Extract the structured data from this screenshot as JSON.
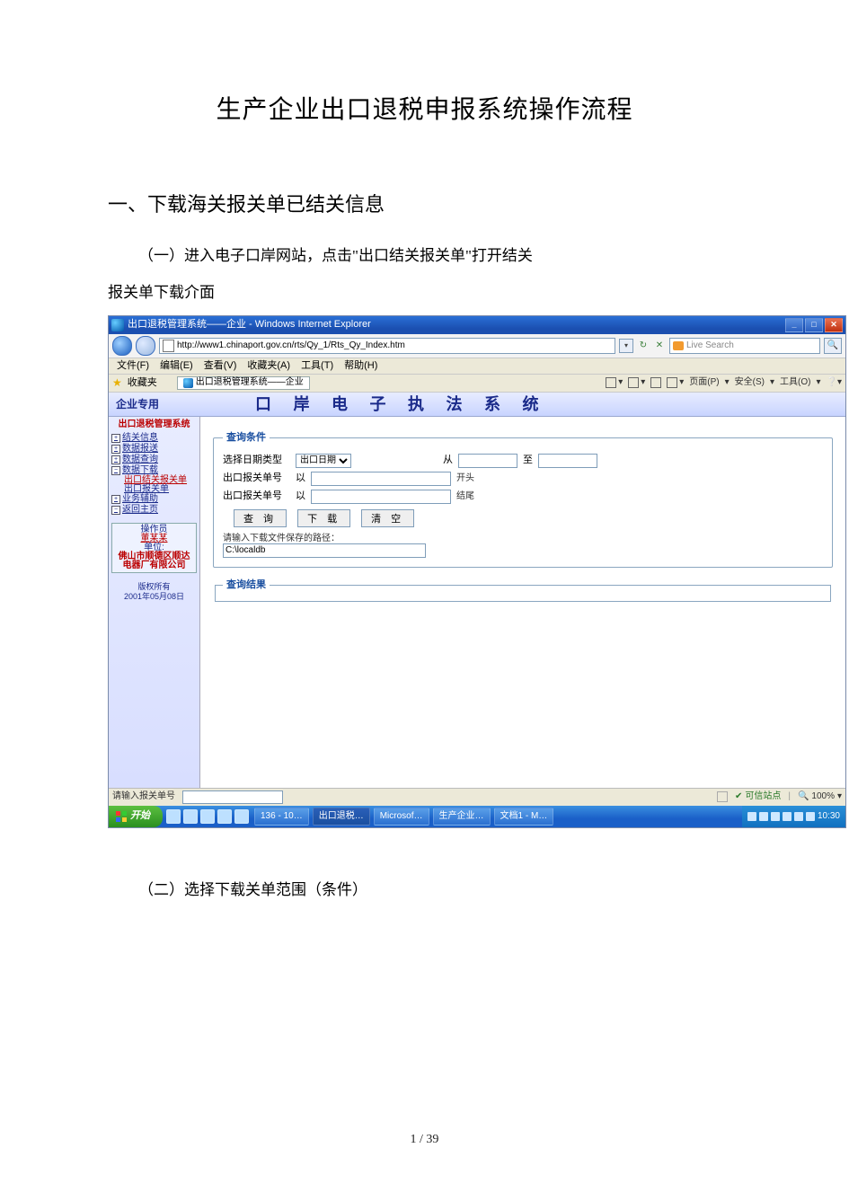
{
  "doc": {
    "title": "生产企业出口退税申报系统操作流程",
    "section1": "一、下载海关报关单已结关信息",
    "p1a": "（一）进入电子口岸网站，点击\"出口结关报关单\"打开结关",
    "p1b": "报关单下载介面",
    "p2": "（二）选择下载关单范围（条件）",
    "page_number": "1 / 39"
  },
  "ie": {
    "window_title": "出口退税管理系统——企业 - Windows Internet Explorer",
    "url": "http://www1.chinaport.gov.cn/rts/Qy_1/Rts_Qy_Index.htm",
    "search_placeholder": "Live Search",
    "menu": {
      "file": "文件(F)",
      "edit": "编辑(E)",
      "view": "查看(V)",
      "favorites": "收藏夹(A)",
      "tools": "工具(T)",
      "help": "帮助(H)"
    },
    "fav_label": "收藏夹",
    "tab_title": "出口退税管理系统——企业",
    "toolbar": {
      "page": "页面(P)",
      "safety": "安全(S)",
      "tools": "工具(O)"
    },
    "status": {
      "prompt": "请输入报关单号",
      "trusted": "可信站点",
      "zoom": "100%"
    }
  },
  "app": {
    "left_heading": "企业专用",
    "banner": "口 岸 电 子 执 法 系 统",
    "sidebar": {
      "title": "出口退税管理系统",
      "items": {
        "customs_info": "结关信息",
        "data_send": "数据报送",
        "data_query": "数据查询",
        "data_download": "数据下载",
        "sub_export_customs": "出口结关报关单",
        "sub_export_form": "出口报关单",
        "biz_support": "业务辅助",
        "back_home": "返回主页"
      },
      "operator_label": "操作员",
      "operator_name": "董某某",
      "company_label": "单位:",
      "company_name": "佛山市顺德区顺达电器厂有限公司",
      "copyright_l1": "版权所有",
      "copyright_l2": "2001年05月08日"
    },
    "form": {
      "legend_query": "查询条件",
      "label_date_type": "选择日期类型",
      "date_type_option": "出口日期",
      "label_from": "从",
      "label_to": "至",
      "label_no_start": "出口报关单号",
      "label_prefix_start": "以",
      "suffix_start": "开头",
      "label_no_end": "出口报关单号",
      "label_prefix_end": "以",
      "suffix_end": "结尾",
      "btn_query": "查 询",
      "btn_download": "下 载",
      "btn_clear": "清 空",
      "hint": "请输入下载文件保存的路径：",
      "path_value": "C:\\localdb",
      "legend_result": "查询结果"
    }
  },
  "taskbar": {
    "start": "开始",
    "tasks": {
      "t1": "136 - 10…",
      "t2": "出口退税…",
      "t3": "Microsof…",
      "t4": "生产企业…",
      "t5": "文档1 - M…"
    },
    "clock": "10:30"
  }
}
